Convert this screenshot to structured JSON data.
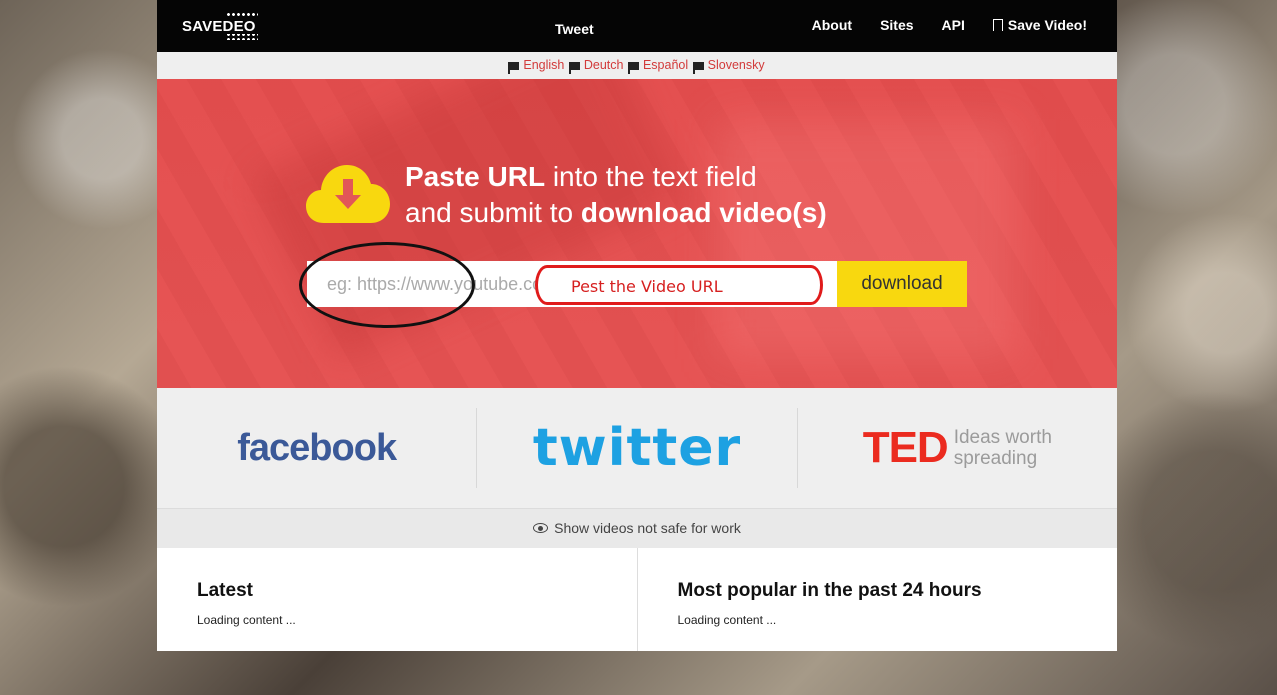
{
  "header": {
    "logo_text": "SAVEDEO",
    "tweet_label": "Tweet",
    "nav": {
      "about": "About",
      "sites": "Sites",
      "api": "API",
      "save_video": "Save Video!"
    }
  },
  "languages": [
    "English",
    "Deutch",
    "Español",
    "Slovensky"
  ],
  "hero": {
    "line1_bold": "Paste URL",
    "line1_rest": " into the text field",
    "line2_rest": "and submit to ",
    "line2_bold": "download video(s)",
    "input_placeholder": "eg: https://www.youtube.com/watch?v=",
    "download_label": "download",
    "annotation": "Pest the Video URL"
  },
  "brands": {
    "facebook": "facebook",
    "twitter": "twitter",
    "ted": "TED",
    "ted_tag_1": "Ideas worth",
    "ted_tag_2": "spreading"
  },
  "nsfw_label": "Show videos not safe for work",
  "lists": {
    "latest_title": "Latest",
    "latest_status": "Loading content ...",
    "popular_title": "Most popular in the past 24 hours",
    "popular_status": "Loading content ..."
  },
  "colors": {
    "accent_red": "#e25757",
    "download_yellow": "#f8d80f",
    "link_red": "#d23a3a"
  }
}
